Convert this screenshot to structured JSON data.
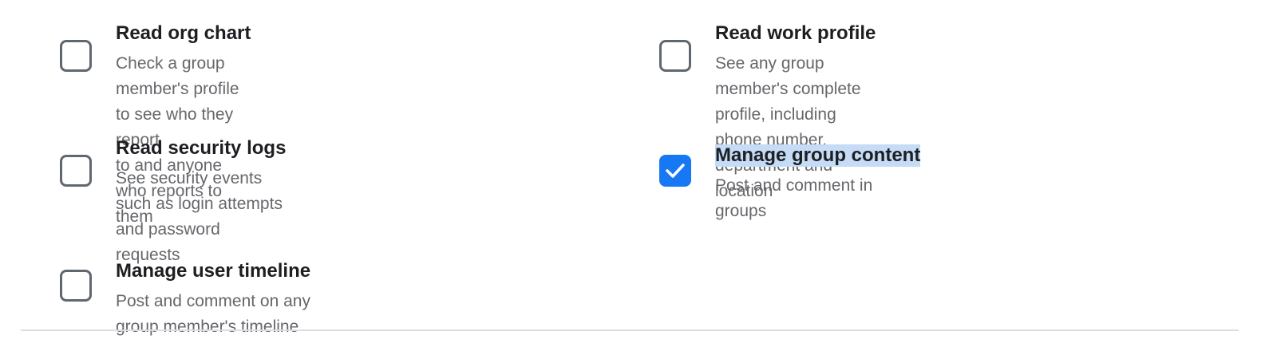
{
  "permissions": [
    {
      "title": "Read org chart",
      "description_line1": "Check a group member's profile to see who they report",
      "description_line2": "to and anyone who reports to them",
      "checked": false
    },
    {
      "title": "Read work profile",
      "description_line1": "See any group member's complete profile, including",
      "description_line2": "phone number, department and location",
      "checked": false
    },
    {
      "title": "Read security logs",
      "description_line1": "See security events such as login attempts and password",
      "description_line2": "requests",
      "checked": false
    },
    {
      "title": "Manage group content",
      "description_line1": "Post and comment in groups",
      "checked": true
    },
    {
      "title": "Manage user timeline",
      "description_line1": "Post and comment on any group member's timeline",
      "checked": false
    }
  ],
  "colors": {
    "accent": "#1877f2",
    "selection": "#c5dbf6",
    "checkbox_border": "#606770",
    "title_text": "#1c1e21",
    "description_text": "#65676b"
  }
}
